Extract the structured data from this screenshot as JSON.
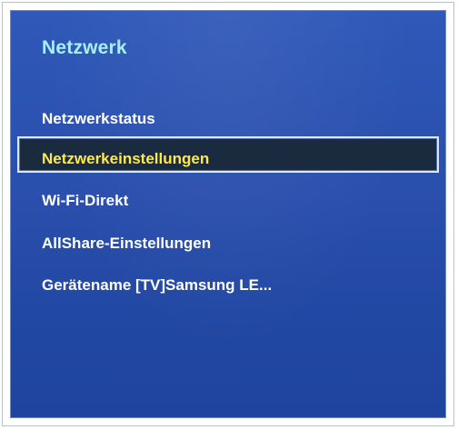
{
  "menu": {
    "title": "Netzwerk",
    "items": [
      {
        "label": "Netzwerkstatus",
        "selected": false
      },
      {
        "label": "Netzwerkeinstellungen",
        "selected": true
      },
      {
        "label": "Wi-Fi-Direkt",
        "selected": false
      },
      {
        "label": "AllShare-Einstellungen",
        "selected": false
      },
      {
        "label": "Gerätename  [TV]Samsung LE...",
        "selected": false
      }
    ]
  },
  "colors": {
    "panel_background": "#2a4fad",
    "title_text": "#a7f0f1",
    "item_text": "#ffffff",
    "selected_text": "#ffe84a",
    "selected_background": "#1a2a3f",
    "selected_border": "#dce7f7"
  }
}
